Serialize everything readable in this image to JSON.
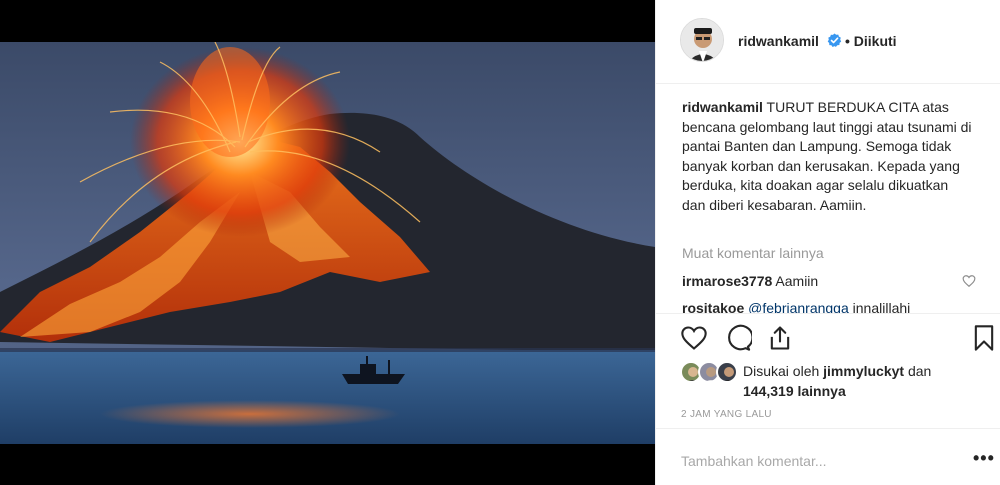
{
  "post": {
    "username": "ridwankamil",
    "follow_status": "• Diikuti",
    "caption_user": "ridwankamil",
    "caption_text": " TURUT BERDUKA CITA atas bencana gelombang laut tinggi atau tsunami di pantai Banten dan Lampung. Semoga tidak banyak korban dan kerusakan. Kepada yang berduka, kita doakan agar selalu dikuatkan dan diberi kesabaran. Aamiin.",
    "load_more": "Muat komentar lainnya",
    "comments": [
      {
        "user": "irmarose3778",
        "text": " Aamiin"
      },
      {
        "user": "rositakoe",
        "mention": "@febrianrangga",
        "text": " innalillahi"
      }
    ],
    "likes_prefix": "Disukai oleh ",
    "likes_user": "jimmyluckyt",
    "likes_middle": " dan ",
    "likes_count": "144,319 lainnya",
    "time_ago": "2 JAM YANG LALU",
    "add_comment_placeholder": "Tambahkan komentar...",
    "more_options": "•••"
  },
  "icons": {
    "verified": "verified-badge-icon",
    "like": "heart-icon",
    "comment": "comment-bubble-icon",
    "share": "share-icon",
    "save": "bookmark-icon",
    "more": "more-options-icon"
  },
  "colors": {
    "verified_blue": "#3897f0",
    "text": "#262626",
    "muted": "#999999",
    "mention": "#003569",
    "divider": "#efefef"
  }
}
